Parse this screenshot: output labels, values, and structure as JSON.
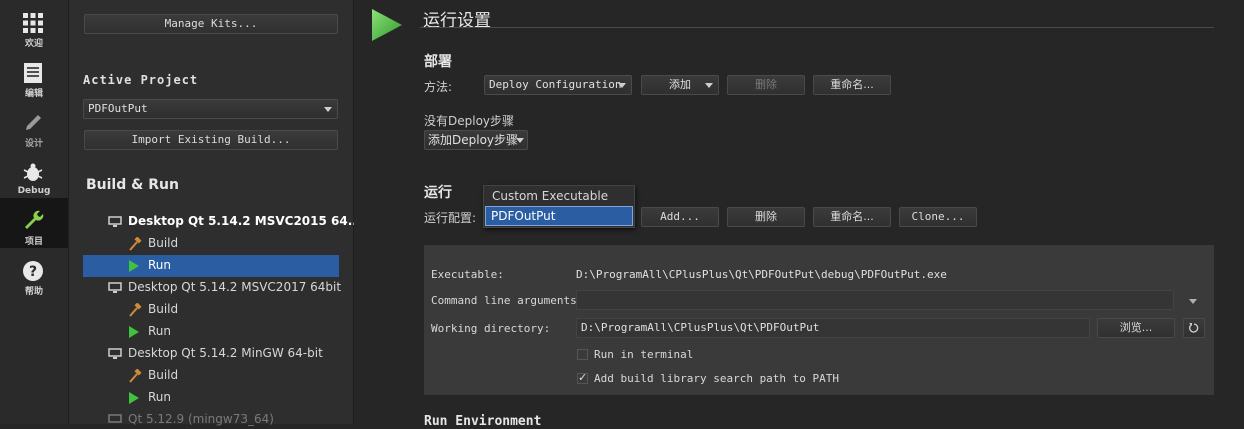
{
  "modebar": {
    "items": [
      {
        "label": "欢迎",
        "icon": "grid-icon"
      },
      {
        "label": "编辑",
        "icon": "document-icon"
      },
      {
        "label": "设计",
        "icon": "pen-icon"
      },
      {
        "label": "Debug",
        "icon": "bug-icon"
      },
      {
        "label": "项目",
        "icon": "wrench-icon"
      },
      {
        "label": "帮助",
        "icon": "help-icon"
      }
    ]
  },
  "project_panel": {
    "manage_kits_label": "Manage Kits...",
    "active_project_heading": "Active Project",
    "project_combo_value": "PDFOutPut",
    "import_build_label": "Import Existing Build...",
    "build_run_heading": "Build & Run",
    "tree": [
      {
        "kit": "Desktop Qt 5.14.2 MSVC2015 64...",
        "build": "Build",
        "run": "Run"
      },
      {
        "kit": "Desktop Qt 5.14.2 MSVC2017 64bit",
        "build": "Build",
        "run": "Run"
      },
      {
        "kit": "Desktop Qt 5.14.2 MinGW 64-bit",
        "build": "Build",
        "run": "Run"
      },
      {
        "kit": "Qt 5.12.9 (mingw73_64)"
      }
    ]
  },
  "main": {
    "title": "运行设置",
    "deploy": {
      "heading": "部署",
      "method_label": "方法:",
      "config_combo": "Deploy Configuration",
      "add_label": "添加",
      "delete_label": "删除",
      "rename_label": "重命名...",
      "no_steps_text": "没有Deploy步骤",
      "add_step_label": "添加Deploy步骤"
    },
    "run": {
      "heading": "运行",
      "config_label": "运行配置:",
      "dropdown_options": [
        "Custom Executable",
        "PDFOutPut"
      ],
      "add_label": "Add...",
      "delete_label": "删除",
      "rename_label": "重命名...",
      "clone_label": "Clone...",
      "executable_label": "Executable:",
      "executable_value": "D:\\ProgramAll\\CPlusPlus\\Qt\\PDFOutPut\\debug\\PDFOutPut.exe",
      "args_label": "Command line arguments:",
      "args_value": "",
      "workdir_label": "Working directory:",
      "workdir_value": "D:\\ProgramAll\\CPlusPlus\\Qt\\PDFOutPut",
      "browse_label": "浏览...",
      "run_in_terminal_label": "Run in terminal",
      "add_lib_path_label": "Add build library search path to PATH"
    },
    "run_env_heading": "Run Environment"
  }
}
